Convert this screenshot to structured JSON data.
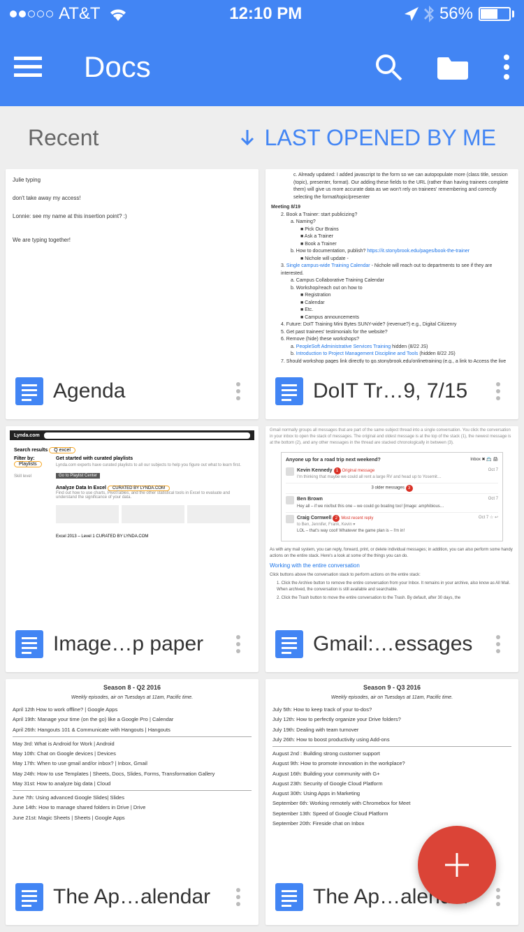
{
  "status_bar": {
    "carrier": "AT&T",
    "time": "12:10 PM",
    "battery_pct": "56%"
  },
  "app_bar": {
    "title": "Docs"
  },
  "sort": {
    "label": "Recent",
    "option": "LAST OPENED BY ME"
  },
  "docs": [
    {
      "title": "Agenda"
    },
    {
      "title": "DoIT Tr…9, 7/15"
    },
    {
      "title": "Image…p paper"
    },
    {
      "title": "Gmail:…essages"
    },
    {
      "title": "The Ap…alendar"
    },
    {
      "title": "The Ap…alendar"
    }
  ],
  "thumbs": {
    "agenda": {
      "l1": "Julie typing",
      "l2": "don't take away my access!",
      "l3": "Lonnie: see my name at this insertion point?  :)",
      "l4": "We are typing together!"
    },
    "doit": {
      "header": "Meeting 8/19",
      "already": "Already updated: I added javascript to the form so we can autopopulate more (class title, session (topic), presenter, format). Our adding these fields to the URL (rather than having trainees complete them) will give us more accurate data as we won't rely on trainees' remembering and correctly selecting the format/topic/presenter",
      "item2": "Book a Trainer: start publicizing?",
      "item2a": "Naming?",
      "item2a1": "Pick Our Brains",
      "item2a2": "Ask a Trainer",
      "item2a3": "Book a Trainer",
      "item2b": "How to documentation, publish?",
      "item2b1": "Nichole will update -",
      "item3": "Single campus-wide Training Calendar",
      "item3b": " - Nichole will reach out to departments to see if they are interested.",
      "item3c": "Campus Collaborative Training Calendar",
      "item3d": "Workshop/reach out on how to",
      "item3d1": "Registration",
      "item3d2": "Calendar",
      "item3d3": "Etc.",
      "item3d4": "Campus announcements",
      "item4": "Future: DoIT Training Mini Bytes SUNY-wide? (revenue?) e.g., Digital Citizenry",
      "item5": "Get past trainees' testimonials for the website?",
      "item6": "Remove (hide) these workshops?",
      "item6a": "PeopleSoft Administrative Services Training",
      "item6ab": " hidden (8/22 JS)",
      "item6b": "Introduction to Project Management Discipline and Tools",
      "item6bb": " (hidden 8/22 JS)",
      "item7": "Should workshop pages link directly to go.stonybrook.edu/onlinetraining (e.g., a link to Access the live Training from the workshop page)?"
    },
    "lynda": {
      "logo": "Lynda.com",
      "sr": "Search results",
      "filter": "Filter by:",
      "playlists": "Playlists",
      "started": "Get started with curated playlists",
      "analyze": "Analyze Data In Excel",
      "curated": "CURATED BY LYNDA.COM",
      "excel": "Excel 2013 – Level 1    CURATED BY LYNDA.COM"
    },
    "gmail": {
      "subject": "Anyone up for a road trip next weekend?",
      "n1": "Kevin Kennedy",
      "n1t": "Original message",
      "older": "3 older messages",
      "n2": "Ben Brown",
      "n2l": "Hey all – if we nix/but this one – we could go boating too! [image: amphibious…",
      "n3": "Craig Cornwell",
      "n3t": "Most recent reply",
      "n3l": "LOL – that's way cool! Whatever the game plan is – I'm in!",
      "p1": "As with any mail system, you can reply, forward, print, or delete individual messages; in addition, you can also perform some handy actions on the entire stack. Here's a look at some of the things you can do.",
      "h2": "Working with the entire conversation",
      "p2": "Click buttons above the conversation stack to perform actions on the entire stack:",
      "li1": "Click the Archive button to remove the entire conversation from your Inbox. It remains in your archive, also know as All Mail. When archived, the conversation is still available and searchable.",
      "li2": "Click the Trash button to move the entire conversation to the Trash. By default, after 30 days, the"
    },
    "s8": {
      "title": "Season 8 - Q2 2016",
      "subtitle": "Weekly episodes, air on Tuesdays at 11am, Pacific time.",
      "e1": "April 12th How to work offline?  | Google Apps",
      "e2": "April 19th: Manage your time (on the go) like a Google Pro | Calendar",
      "e3": "April 26th: Hangouts 101 & Communicate with Hangouts  | Hangouts",
      "e4": "May 3rd:  What is Android for Work | Android",
      "e5": "May 10th:  Chat on Google devices | Devices",
      "e6": "May 17th: When to use gmail and/or inbox?  | Inbox, Gmail",
      "e7": "May 24th: How to use Templates | Sheets, Docs, Slides, Forms, Transformation Gallery",
      "e8": "May 31st: How to analyze big data | Cloud",
      "e9": "June 7th: Using advanced Google Slides| Slides",
      "e10": "June 14th: How to manage shared folders in Drive | Drive",
      "e11": "June 21st: Magic Sheets | Sheets | Google Apps"
    },
    "s9": {
      "title": "Season 9 - Q3 2016",
      "subtitle": "Weekly episodes, air on Tuesdays at 11am, Pacific time.",
      "e1": "July 5th: How to keep track of your to-dos?",
      "e2": "July 12th: How to perfectly organize your Drive folders?",
      "e3": "July 19th: Dealing with team turnover",
      "e4": "July 26th: How to boost productivity using Add-ons",
      "e5": "August 2nd :  Building strong customer support",
      "e6": "August 9th: How to promote innovation in the workplace?",
      "e7": "August 16th: Building your community with G+",
      "e8": "August 23th: Security of Google Cloud Platform",
      "e9": "August 30th: Using Apps in Marketing",
      "e10": "September 6th: Working remotely with Chromebox for Meet",
      "e11": "September 13th: Speed of Google Cloud Platform",
      "e12": "September 20th: Fireside chat on Inbox"
    }
  }
}
